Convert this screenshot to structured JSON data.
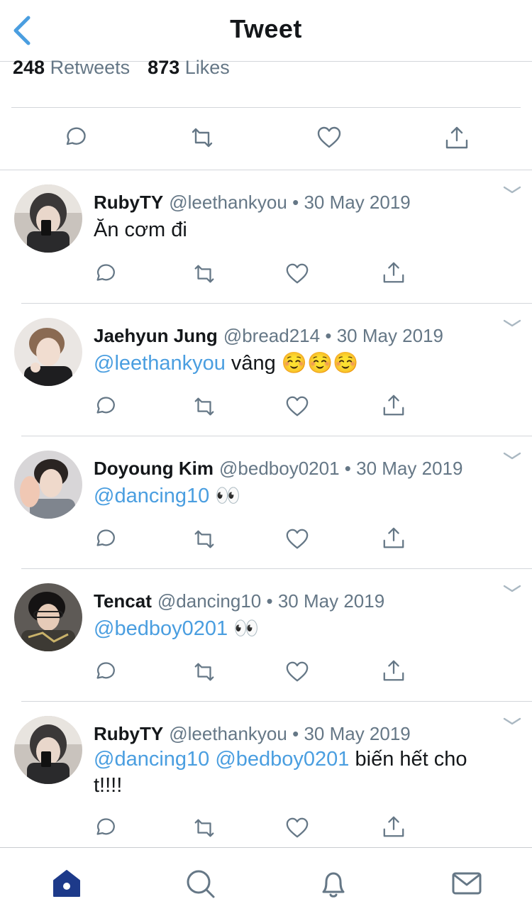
{
  "header": {
    "title": "Tweet",
    "back_icon": "chevron-left-icon"
  },
  "stats": {
    "retweets_count": "248",
    "retweets_label": "Retweets",
    "likes_count": "873",
    "likes_label": "Likes"
  },
  "colors": {
    "accent": "#4a9ee0",
    "text": "#14171a",
    "secondary": "#657786",
    "icon_gray": "#657786",
    "tab_active": "#1d3a8a"
  },
  "replies": [
    {
      "name": "RubyTY",
      "handle": "@leethankyou",
      "date": "30 May 2019",
      "text": "Ăn cơm đi",
      "mentions": []
    },
    {
      "name": "Jaehyun Jung",
      "handle": "@bread214",
      "date": "30 May 2019",
      "mentions": [
        "@leethankyou"
      ],
      "text": "vâng ☺️☺️☺️"
    },
    {
      "name": "Doyoung Kim",
      "handle": "@bedboy0201",
      "date": "30 May 2019",
      "mentions": [
        "@dancing10"
      ],
      "text": "👀"
    },
    {
      "name": "Tencat",
      "handle": "@dancing10",
      "date": "30 May 2019",
      "mentions": [
        "@bedboy0201"
      ],
      "text": "👀"
    },
    {
      "name": "RubyTY",
      "handle": "@leethankyou",
      "date": "30 May 2019",
      "mentions": [
        "@dancing10",
        "@bedboy0201"
      ],
      "text": "biến hết cho t!!!!"
    }
  ],
  "separator": "•",
  "tabbar": [
    "home-icon",
    "search-icon",
    "notifications-bell-icon",
    "messages-envelope-icon"
  ]
}
